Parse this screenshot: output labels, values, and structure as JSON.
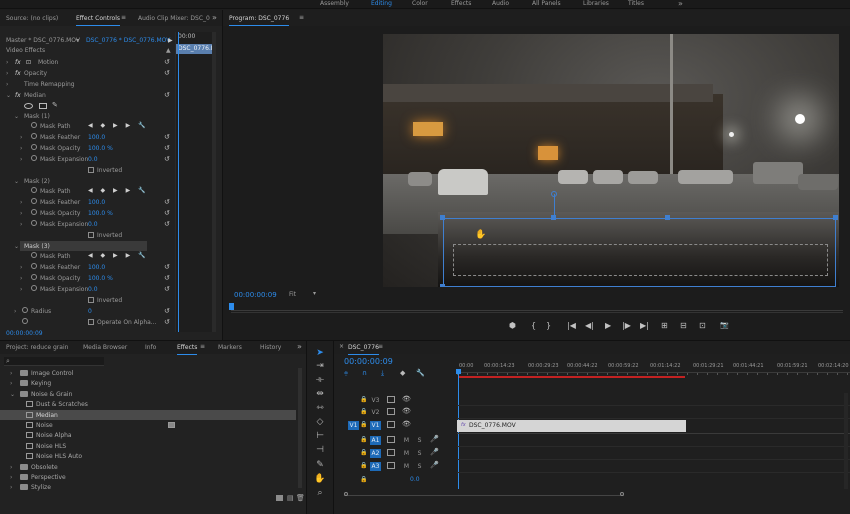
{
  "workspaces": [
    "Assembly",
    "Editing",
    "Color",
    "Effects",
    "Audio",
    "All Panels",
    "Libraries",
    "Titles"
  ],
  "workspace_menu": "»",
  "source_panel": {
    "tabs": [
      "Source: (no clips)",
      "Effect Controls",
      "Audio Clip Mixer: DSC_0"
    ],
    "clip_path": "Master * DSC_0776.MOV",
    "clip_active": "DSC_0776 * DSC_0776.MOV",
    "mini_timecode": "00:00",
    "mini_clip": "DSC_0776.M",
    "section": "Video Effects",
    "effects": [
      {
        "label": "Motion",
        "fx": "fx"
      },
      {
        "label": "Opacity",
        "fx": "fx"
      },
      {
        "label": "Time Remapping",
        "fx": ""
      },
      {
        "label": "Median",
        "fx": "fx"
      }
    ],
    "masks": [
      {
        "name": "Mask (1)",
        "path": "Mask Path",
        "feather_label": "Mask Feather",
        "feather": "100.0",
        "opacity_label": "Mask Opacity",
        "opacity": "100.0 %",
        "expansion_label": "Mask Expansion",
        "expansion": "0.0",
        "inverted": "Inverted"
      },
      {
        "name": "Mask (2)",
        "path": "Mask Path",
        "feather_label": "Mask Feather",
        "feather": "100.0",
        "opacity_label": "Mask Opacity",
        "opacity": "100.0 %",
        "expansion_label": "Mask Expansion",
        "expansion": "0.0",
        "inverted": "Inverted"
      },
      {
        "name": "Mask (3)",
        "path": "Mask Path",
        "feather_label": "Mask Feather",
        "feather": "100.0",
        "opacity_label": "Mask Opacity",
        "opacity": "100.0 %",
        "expansion_label": "Mask Expansion",
        "expansion": "0.0",
        "inverted": "Inverted"
      }
    ],
    "radius_label": "Radius",
    "radius_value": "0",
    "alpha_label": "Operate On Alpha...",
    "footer_timecode": "00:00:00:09",
    "keyframe_controls": "◀ ◆ ▶ ▶ 🔧"
  },
  "program": {
    "title": "Program: DSC_0776",
    "timecode": "00:00:00:09",
    "zoom": "Fit",
    "transport": [
      "⬢",
      "{",
      "}",
      "|◀",
      "◀|",
      "▶",
      "|▶",
      "▶|",
      "⊞",
      "⊟",
      "⊡",
      "📷"
    ]
  },
  "project_panel": {
    "tabs": [
      "Project: reduce grain",
      "Media Browser",
      "Info",
      "Effects",
      "Markers",
      "History"
    ],
    "more": "»",
    "search_placeholder": "",
    "tree": [
      {
        "label": "Image Control",
        "type": "folder",
        "level": 1
      },
      {
        "label": "Keying",
        "type": "folder",
        "level": 1
      },
      {
        "label": "Noise & Grain",
        "type": "folder",
        "level": 1,
        "open": true
      },
      {
        "label": "Dust & Scratches",
        "type": "effect",
        "level": 2
      },
      {
        "label": "Median",
        "type": "effect",
        "level": 2,
        "selected": true
      },
      {
        "label": "Noise",
        "type": "effect",
        "level": 2
      },
      {
        "label": "Noise Alpha",
        "type": "effect",
        "level": 2
      },
      {
        "label": "Noise HLS",
        "type": "effect",
        "level": 2
      },
      {
        "label": "Noise HLS Auto",
        "type": "effect",
        "level": 2
      },
      {
        "label": "Obsolete",
        "type": "folder",
        "level": 1
      },
      {
        "label": "Perspective",
        "type": "folder",
        "level": 1
      },
      {
        "label": "Stylize",
        "type": "folder",
        "level": 1
      }
    ]
  },
  "timeline": {
    "title": "DSC_0776",
    "timecode": "00:00:00:09",
    "ruler": [
      "00:00",
      "00:00:14:23",
      "00:00:29:23",
      "00:00:44:22",
      "00:00:59:22",
      "00:01:14:22",
      "00:01:29:21",
      "00:01:44:21",
      "00:01:59:21",
      "00:02:14:20"
    ],
    "video_tracks": [
      "V3",
      "V2",
      "V1"
    ],
    "audio_tracks": [
      "A1",
      "A2",
      "A3"
    ],
    "source_patch": "V1",
    "clip_label": "DSC_0776.MOV",
    "clip_fx": "fx",
    "mix_value": "0.0",
    "track_buttons": {
      "mute": "M",
      "solo": "S"
    }
  },
  "colors": {
    "accent": "#2d8ceb",
    "clip": "#d5d5d5",
    "selected_track": "#1d6ab8",
    "work_area": "#c32222"
  }
}
